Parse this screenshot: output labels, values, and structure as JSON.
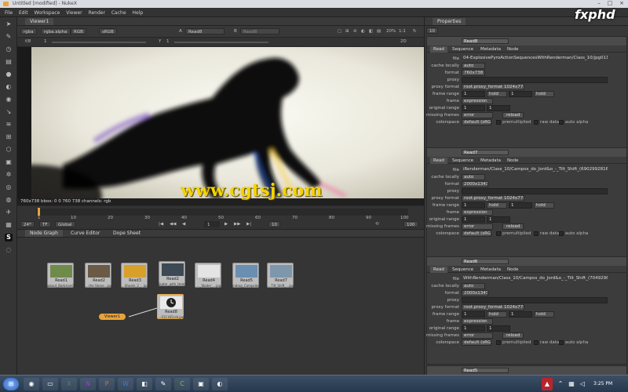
{
  "window": {
    "title": "Untitled [modified] - NukeX"
  },
  "menu": [
    "File",
    "Edit",
    "Workspace",
    "Viewer",
    "Render",
    "Cache",
    "Help"
  ],
  "viewer_tab": "Viewer1",
  "viewer_controls": {
    "channels": "rgba",
    "alpha": "rgba.alpha",
    "colorspace_a": "RGB",
    "colorspace_b": "sRGB",
    "input_a_label": "A",
    "input_a": "Read8",
    "input_b_label": "B",
    "input_b": "Read8",
    "zoom": "20%",
    "ratio": "1:1",
    "f_label": "f/8",
    "gain": "1",
    "y_label": "Y",
    "gamma": "1",
    "mode": "2D"
  },
  "viewer_info": "760x738  bbox: 0 0 760 738 channels: rgb",
  "timeline": {
    "ticks": [
      "1",
      "10",
      "20",
      "30",
      "40",
      "50",
      "60",
      "70",
      "80",
      "90",
      "100"
    ],
    "fps": "24*",
    "tf": "TF",
    "scope": "Global",
    "current_frame": "1",
    "frame_end": "100",
    "step": "10"
  },
  "bottom_tabs": [
    "Node Graph",
    "Curve Editor",
    "Dope Sheet"
  ],
  "nodes": [
    {
      "name": "Read1",
      "sub": "Freakout_Barbrian02kthrasi_BT_2500pdf.jpg",
      "thumb": "#6f8b4a"
    },
    {
      "name": "Read2",
      "sub": "...the Stone...jpg",
      "thumb": "#6a5a46"
    },
    {
      "name": "Read3",
      "sub": "...Shoots_2_...jpg",
      "thumb": "#d8a02a"
    },
    {
      "name": "Read2",
      "sub": "...Skater_with_Helmet...jpg",
      "thumb": "#3d4a55"
    },
    {
      "name": "Read4",
      "sub": "..._Skater_...jpg",
      "thumb": "#e4e4e4"
    },
    {
      "name": "Read5",
      "sub": "Raindrop_Campsite...Tilt_Shift...",
      "thumb": "#6a8fb0"
    },
    {
      "name": "Read7",
      "sub": "...Tilt_Shift_...jpg",
      "thumb": "#7d97ad"
    },
    {
      "name": "Read8",
      "sub": "...011165crb.jpg",
      "thumb": "#202020"
    }
  ],
  "viewer_node": "Viewer1",
  "properties": {
    "title": "Properties",
    "max_panels": "10",
    "panels": [
      {
        "name": "Read8",
        "tabs": [
          "Read",
          "Sequence",
          "Metadata",
          "Node"
        ],
        "file": "04-ExplosivePyroActionSequencesWithRenderman/Class_10/jpg011165crb.jpg",
        "cache_locally": "auto",
        "format": "760x738",
        "proxy": "",
        "proxy_format": "root.proxy_format 1024x778",
        "frame_range_start": "1",
        "frame_range_start_mode": "hold",
        "frame_range_end": "1",
        "frame_range_end_mode": "hold",
        "frame": "expression",
        "original_range_start": "1",
        "original_range_end": "1",
        "missing_frames": "error",
        "reload": "reload",
        "colorspace": "default (sRGB)",
        "premultiplied": "premultiplied",
        "raw_data": "raw data",
        "auto_alpha": "auto alpha"
      },
      {
        "name": "Read7",
        "tabs": [
          "Read",
          "Sequence",
          "Metadata",
          "Node"
        ],
        "file": "iRenderman/Class_10/Campos_do_Jord&o_-_Tilt_Shift_(6902992816)_(2).jpg",
        "cache_locally": "auto",
        "format": "2000x1343",
        "proxy": "",
        "proxy_format": "root.proxy_format 1024x778",
        "frame_range_start": "1",
        "frame_range_start_mode": "hold",
        "frame_range_end": "1",
        "frame_range_end_mode": "hold",
        "frame": "expression",
        "original_range_start": "1",
        "original_range_end": "1",
        "missing_frames": "error",
        "reload": "reload",
        "colorspace": "default (sRGB)",
        "premultiplied": "premultiplied",
        "raw_data": "raw data",
        "auto_alpha": "auto alpha"
      },
      {
        "name": "Read6",
        "tabs": [
          "Read",
          "Sequence",
          "Metadata",
          "Node"
        ],
        "file": "WithRenderman/Class_10/Campos_do_Jord&o_-_Tilt_Shift_(7049298627).jpg",
        "cache_locally": "auto",
        "format": "2000x1343",
        "proxy": "",
        "proxy_format": "root.proxy_format 1024x778",
        "frame_range_start": "1",
        "frame_range_start_mode": "hold",
        "frame_range_end": "1",
        "frame_range_end_mode": "hold",
        "frame": "expression",
        "original_range_start": "1",
        "original_range_end": "1",
        "missing_frames": "error",
        "reload": "reload",
        "colorspace": "default (sRGB)",
        "premultiplied": "premultiplied",
        "raw_data": "raw data",
        "auto_alpha": "auto alpha"
      }
    ],
    "labels": {
      "file": "file",
      "cache_locally": "cache locally",
      "format": "format",
      "proxy": "proxy",
      "proxy_format": "proxy format",
      "frame_range": "frame range",
      "frame": "frame",
      "original_range": "original range",
      "missing_frames": "missing frames",
      "colorspace": "colorspace"
    },
    "next_panel": "Read5"
  },
  "watermarks": {
    "site": "www.cgtsj.com",
    "brand": "fxphd"
  },
  "taskbar": {
    "time": "3:25 PM"
  },
  "colors": {
    "node_viewer": "#e7a33a",
    "playhead": "#e7a33a",
    "accent": "#f5d300"
  }
}
